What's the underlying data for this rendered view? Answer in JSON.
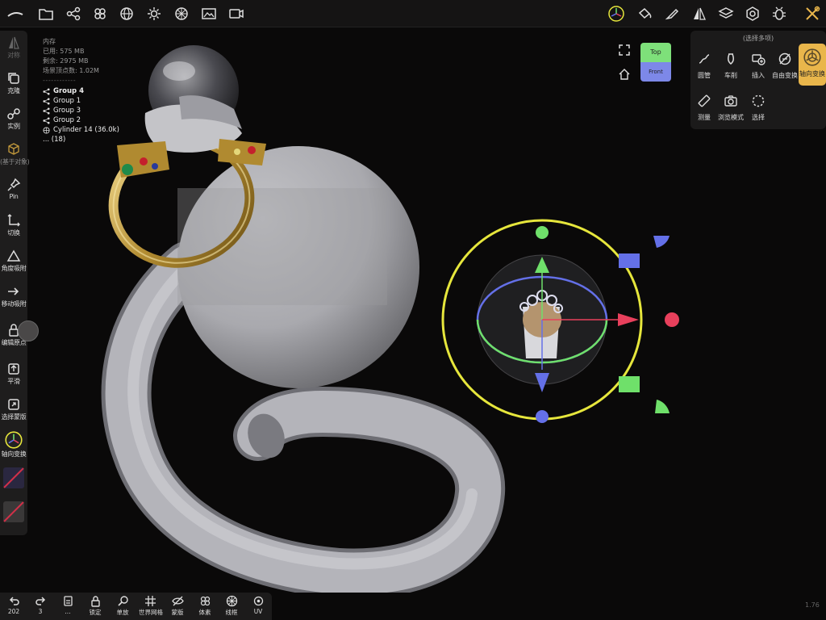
{
  "top_toolbar": {
    "icons": [
      "menu-icon",
      "folder-icon",
      "share-icon",
      "scene-icon",
      "globe-icon",
      "sun-icon",
      "material-icon",
      "image-icon",
      "video-icon"
    ],
    "right_icons": [
      "gizmo-icon",
      "paint-bucket-icon",
      "brush-icon",
      "mirror-icon",
      "layers-icon",
      "settings-icon",
      "bug-icon",
      "tools-icon"
    ]
  },
  "left_toolbar": {
    "items": [
      {
        "label": "对称",
        "icon": "symmetry-icon"
      },
      {
        "label": "克隆",
        "icon": "clone-icon"
      },
      {
        "label": "实例",
        "icon": "instance-icon"
      },
      {
        "label": "(基于对象)",
        "icon": "cube-icon"
      },
      {
        "label": "Pin",
        "icon": "pin-icon"
      },
      {
        "label": "切换",
        "icon": "switch-icon"
      },
      {
        "label": "角度吸附",
        "icon": "angle-snap-icon"
      },
      {
        "label": "移动吸附",
        "icon": "move-snap-icon"
      },
      {
        "label": "编辑原点",
        "icon": "lock-icon"
      },
      {
        "label": "平滑",
        "icon": "smooth-icon"
      },
      {
        "label": "选择蒙版",
        "icon": "mask-icon"
      },
      {
        "label": "轴向变换",
        "icon": "axis-transform-icon"
      }
    ]
  },
  "memory": {
    "title": "内存",
    "used": "已用: 575 MB",
    "remaining": "剩余: 2975 MB",
    "vertices": "场景顶点数: 1.02M",
    "divider": "- - - - - - - - - - - -"
  },
  "scene_tree": [
    {
      "label": "Group 4",
      "bold": true
    },
    {
      "label": "Group 1",
      "bold": false
    },
    {
      "label": "Group 3",
      "bold": false
    },
    {
      "label": "Group 2",
      "bold": false
    },
    {
      "label": "Cylinder 14 (36.0k)",
      "bold": false
    },
    {
      "label": "... (18)",
      "bold": false
    }
  ],
  "view_cube": {
    "top": "Top",
    "front": "Front"
  },
  "popup": {
    "title": "(选择多项)",
    "items": [
      {
        "label": "圆管",
        "icon": "tube-icon"
      },
      {
        "label": "车削",
        "icon": "lathe-icon"
      },
      {
        "label": "插入",
        "icon": "insert-icon"
      },
      {
        "label": "自由变换",
        "icon": "free-transform-icon"
      },
      {
        "label": "轴向变换",
        "icon": "axis-transform-icon",
        "active": true
      },
      {
        "label": "测量",
        "icon": "ruler-icon"
      },
      {
        "label": "浏览模式",
        "icon": "camera-icon"
      },
      {
        "label": "选择",
        "icon": "select-icon"
      }
    ]
  },
  "bottom_toolbar": {
    "items": [
      {
        "label": "202",
        "icon": "undo-icon"
      },
      {
        "label": "3",
        "icon": "redo-icon"
      },
      {
        "label": "...",
        "icon": "history-icon"
      },
      {
        "label": "锁定",
        "icon": "lock-icon"
      },
      {
        "label": "单放",
        "icon": "search-icon"
      },
      {
        "label": "世界网格",
        "icon": "grid-icon"
      },
      {
        "label": "蒙版",
        "icon": "eye-off-icon"
      },
      {
        "label": "体素",
        "icon": "voxel-icon"
      },
      {
        "label": "线框",
        "icon": "wireframe-icon"
      },
      {
        "label": "UV",
        "icon": "uv-icon"
      }
    ]
  },
  "version": "1.76",
  "colors": {
    "accent": "#e9b64b",
    "gizmo_yellow": "#e6e63c",
    "axis_x": "#e8405c",
    "axis_y": "#6fe06a",
    "axis_z": "#6470e8",
    "background": "#0a0909"
  }
}
